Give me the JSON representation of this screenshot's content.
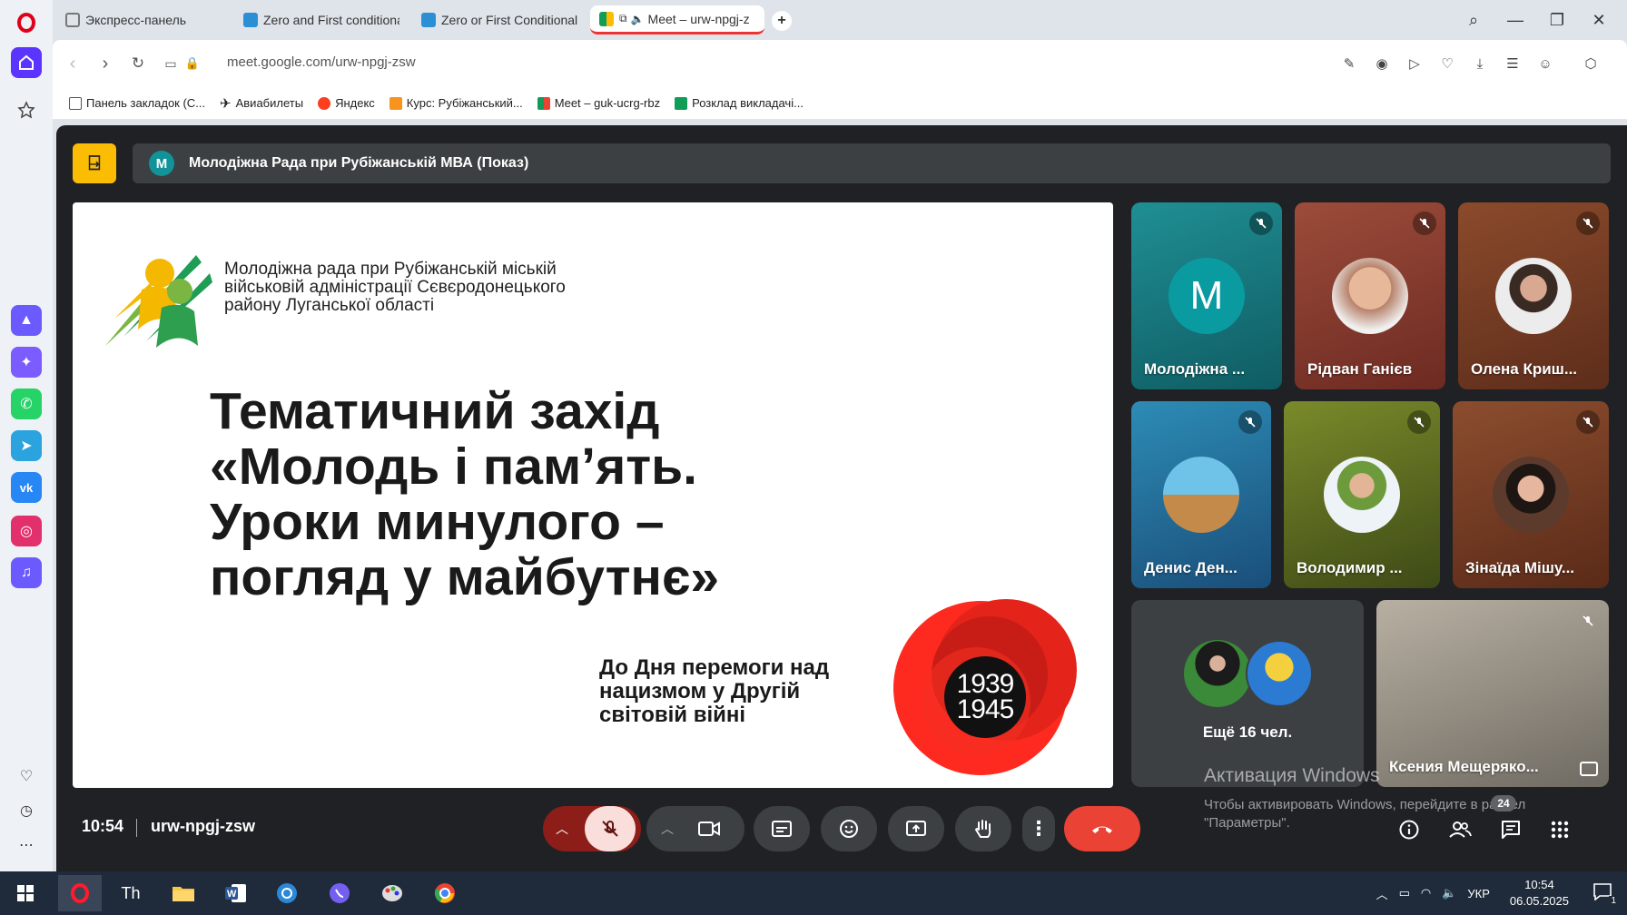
{
  "browser": {
    "tabs": [
      {
        "label": "Экспресс-панель",
        "active": false
      },
      {
        "label": "Zero and First conditional",
        "active": false
      },
      {
        "label": "Zero or First Conditional -",
        "active": false
      },
      {
        "label": "Meet – urw-npgj-z",
        "active": true
      }
    ],
    "url": "meet.google.com/urw-npgj-zsw",
    "bookmarks": [
      "Панель закладок (С...",
      "Авиабилеты",
      "Яндекс",
      "Курс: Рубіжанський...",
      "Meet – guk-ucrg-rbz",
      "Розклад викладачі..."
    ]
  },
  "meet": {
    "presenter_avatar_letter": "M",
    "presenter_title": "Молодіжна Рада при Рубіжанській МВА (Показ)",
    "slide": {
      "org_line1": "Молодіжна рада при Рубіжанській міській",
      "org_line2": "військовій адміністрації Сєвєродонецького",
      "org_line3": "району Луганської області",
      "title_line1": "Тематичний захід",
      "title_line2": "«Молодь і пам’ять.",
      "title_line3": "Уроки минулого –",
      "title_line4": "погляд у майбутнє»",
      "sub_line1": "До Дня перемоги над",
      "sub_line2": "нацизмом у Другій",
      "sub_line3": "світовій війні",
      "year_top": "1939",
      "year_bottom": "1945"
    },
    "participants": [
      {
        "name": "Молодіжна ...",
        "avatar_letter": "M"
      },
      {
        "name": "Рідван Ганієв"
      },
      {
        "name": "Олена Криш..."
      },
      {
        "name": "Денис Ден..."
      },
      {
        "name": "Володимир ..."
      },
      {
        "name": "Зінаїда Мішу..."
      },
      {
        "name": "Ксения Мещеряко..."
      }
    ],
    "more_people": "Ещё 16 чел.",
    "time": "10:54",
    "meeting_code": "urw-npgj-zsw",
    "people_count": "24",
    "activation_title": "Активация Windows",
    "activation_sub": "Чтобы активировать Windows, перейдите в раздел \"Параметры\".",
    "colors": {
      "end_call": "#ea4335",
      "mic_off": "#f9dedc",
      "mic_dark": "#8c1d18"
    }
  },
  "taskbar": {
    "lang": "УКР",
    "time": "10:54",
    "date": "06.05.2025",
    "notifications": "1"
  }
}
